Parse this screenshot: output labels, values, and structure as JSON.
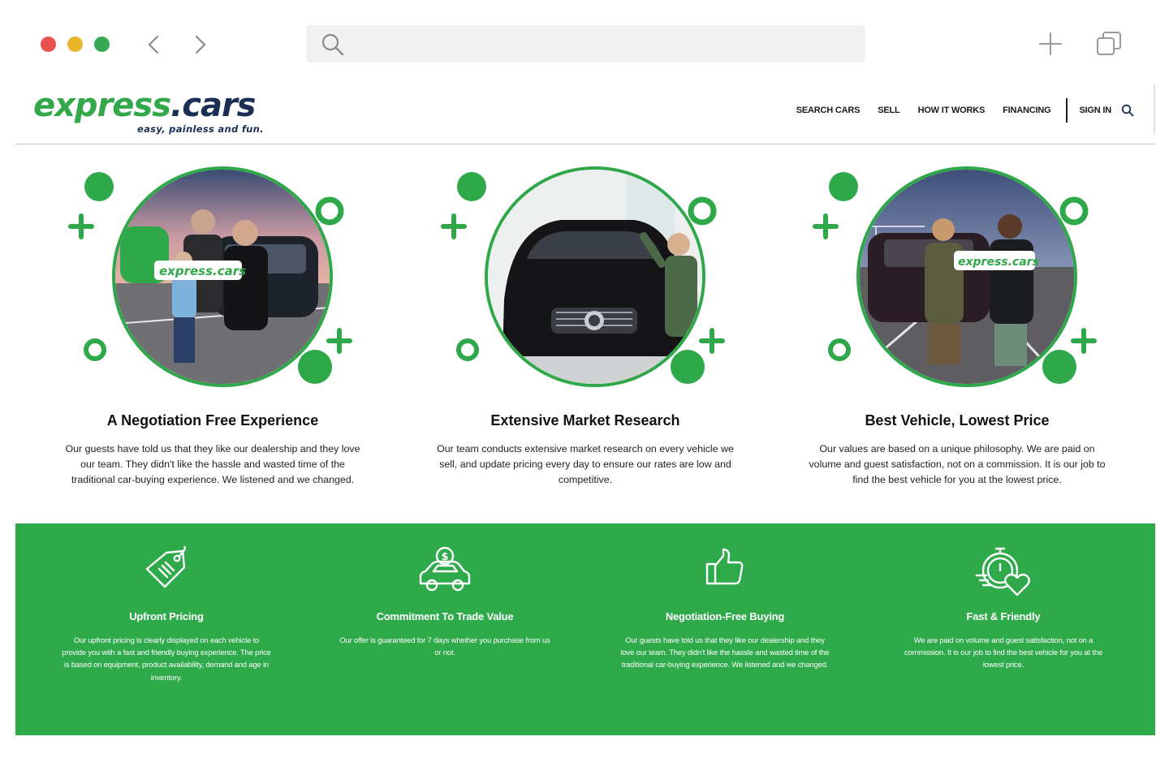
{
  "browser": {
    "icons": [
      "close-dot",
      "minimize-dot",
      "maximize-dot",
      "back-arrow-icon",
      "forward-arrow-icon",
      "search-icon",
      "new-tab-icon",
      "tabs-icon"
    ],
    "colors": {
      "close": "#e9534f",
      "minimize": "#e8b52d",
      "maximize": "#34a853"
    },
    "url_value": ""
  },
  "header": {
    "logo": {
      "express": "express",
      "cars": ".cars",
      "tagline": "easy, painless and fun."
    },
    "nav": [
      "SEARCH CARS",
      "SELL",
      "HOW IT WORKS",
      "FINANCING"
    ],
    "sign_in": "SIGN IN"
  },
  "features": [
    {
      "title": "A Negotiation Free Experience",
      "description": "Our guests have told us that they like our dealership and they love our team. They didn't like the hassle and wasted time of the traditional car-buying experience. We listened and we changed."
    },
    {
      "title": "Extensive Market Research",
      "description": "Our team conducts extensive market research on every vehicle we sell, and update pricing every day to ensure our rates are low and competitive."
    },
    {
      "title": "Best Vehicle, Lowest Price",
      "description": "Our values are based on a unique philosophy. We are paid on volume and guest satisfaction, not on a commission. It is our job to find the best vehicle for you at the lowest price."
    }
  ],
  "benefits": [
    {
      "icon": "price-tag-icon",
      "title": "Upfront Pricing",
      "description": "Our upfront pricing is clearly displayed on each vehicle to provide you with a fast and friendly buying experience. The price is based on equipment, product availability, demand and age in inventory."
    },
    {
      "icon": "car-dollar-icon",
      "title": "Commitment To Trade Value",
      "description": "Our offer is guaranteed for 7 days whether you purchase from us or not."
    },
    {
      "icon": "thumbs-up-icon",
      "title": "Negotiation-Free Buying",
      "description": "Our guests have told us that they like our dealership and they love our team. They didn't like the hassle and wasted time of the traditional car-buying experience. We listened and we changed."
    },
    {
      "icon": "stopwatch-heart-icon",
      "title": "Fast & Friendly",
      "description": "We are paid on volume and guest satisfaction, not on a commission. It is our job to find the best vehicle for you at the lowest price."
    }
  ],
  "colors": {
    "brand_green": "#2eaa4a",
    "brand_navy": "#1b2f55"
  }
}
